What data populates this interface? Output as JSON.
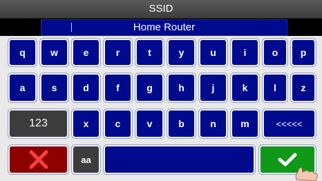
{
  "title": "SSID",
  "field": {
    "value": "Home Router"
  },
  "rows": [
    [
      "q",
      "w",
      "e",
      "r",
      "t",
      "y",
      "u",
      "i",
      "o",
      "p"
    ],
    [
      "a",
      "s",
      "d",
      "f",
      "g",
      "h",
      "j",
      "k",
      "l",
      "z"
    ],
    [
      "x",
      "c",
      "v",
      "b",
      "n",
      "m"
    ]
  ],
  "special": {
    "mode_label": "123",
    "backspace_label": "<<<<<",
    "case_label": "aa"
  },
  "icons": {
    "cancel": "x-icon",
    "confirm": "checkmark-icon",
    "pointer": "hand-pointer-icon"
  },
  "colors": {
    "key_blue": "#000a8c",
    "key_gray": "#3c3c3c",
    "cancel_red": "#8c0000",
    "cancel_x": "#ff4040",
    "confirm_green": "#109818"
  }
}
